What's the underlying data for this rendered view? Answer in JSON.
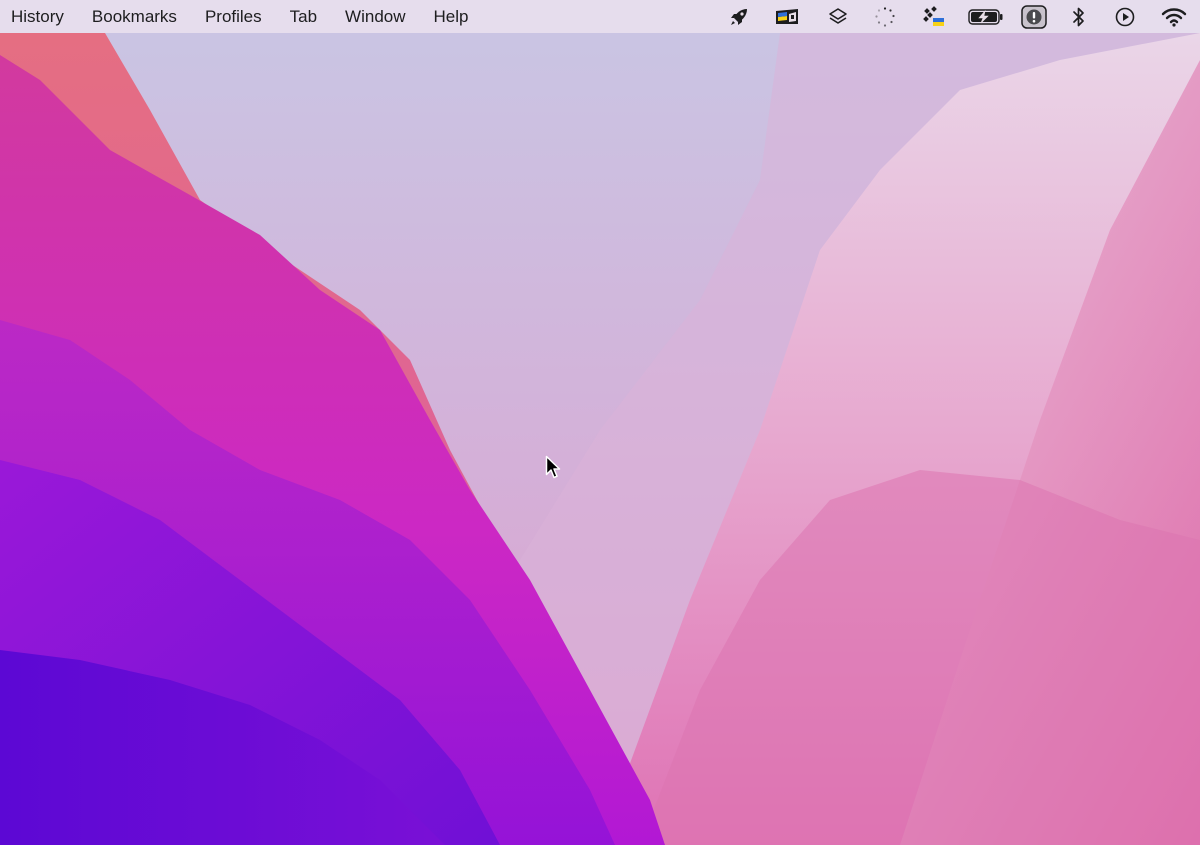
{
  "menubar": {
    "items": [
      {
        "label": "History"
      },
      {
        "label": "Bookmarks"
      },
      {
        "label": "Profiles"
      },
      {
        "label": "Tab"
      },
      {
        "label": "Window"
      },
      {
        "label": "Help"
      }
    ],
    "status_icons": [
      "rocket-icon",
      "flag-display-icon",
      "layers-icon",
      "loading-spinner-icon",
      "grid-flag-icon",
      "battery-charging-icon",
      "alert-icon",
      "bluetooth-icon",
      "play-icon",
      "wifi-icon"
    ]
  },
  "wallpaper": {
    "name": "macOS Monterey",
    "colors": {
      "sky": "#cdc6e2",
      "ridge_orange": "#e0708a",
      "magenta": "#d034b4",
      "purple": "#9d18d6",
      "deep_violet": "#6008d4",
      "pink": "#e07aae"
    }
  }
}
